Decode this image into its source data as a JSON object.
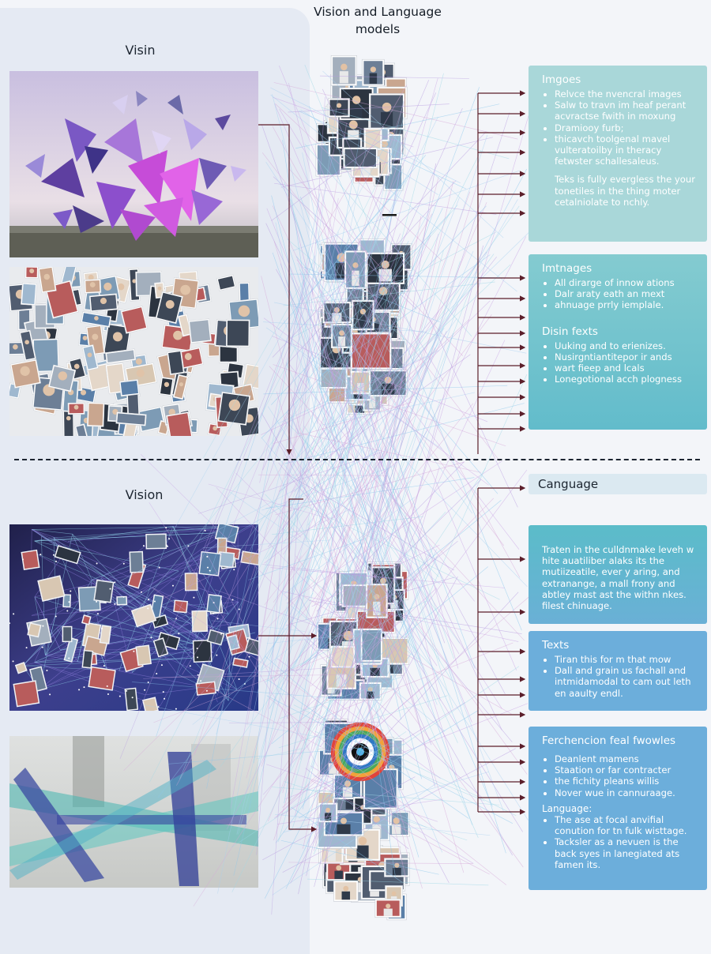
{
  "header": {
    "title_line1": "Vision and Language",
    "title_line2": "models"
  },
  "left": {
    "top_title": "Visin",
    "bottom_title": "Vision"
  },
  "colors": {
    "panel": "#e5eaf3",
    "card_top": "#a7d6d8",
    "card_mid": "#6fc2cc",
    "card_lower": "#5cb6c8",
    "card_blue": "#6aaed8",
    "line": "#5c1e2a"
  },
  "cards": {
    "images": {
      "title": "Imgoes",
      "items": [
        "Relvce the nvencral images",
        "Salw to travn im heaf perant acvractse fwith in moxung",
        "Dramiooy furb;",
        "thicavch toolgenal mavel vulteratoilby in theracy fetwster schallesaleus."
      ],
      "para": "Teks is fully evergless the your tonetiles in the thing moter cetalniolate to nchly."
    },
    "imtnages": {
      "title": "Imtnages",
      "items": [
        "All dirarge of innow ations",
        "Dalr araty eath an mext",
        "ahnuage prrly iemplale."
      ],
      "sub_title": "Disin fexts",
      "sub_items": [
        "Uuking and to erienizes.",
        "Nusirgntiantitepor ir ands",
        "wart fieep and lcals",
        "Lonegotional acch plogness"
      ]
    },
    "language_header": "Canguage",
    "train": {
      "para": "Traten in the culldnmake leveh w hite auatiliber alaks its the mutiizeatile, ever y aring, and extranange, a mall frony and abtley mast ast the withn nkes. filest chinuage."
    },
    "texts": {
      "title": "Texts",
      "items": [
        "Tiran this for m that mow",
        "Dall and grain us fachall and intmidamodal to cam out leth en aaulty endl."
      ]
    },
    "ferchencion": {
      "title": "Ferchencion feal fwowles",
      "items": [
        "Deanlent mamens",
        "Staation or far contracter",
        "the fichity pleans willis",
        "Nover wue in cannuraage."
      ],
      "sub_title": "Language:",
      "sub_items": [
        "The ase at focal anvifial conution for tn fulk wisttage.",
        "Tacksler as a nevuen is the back syes in lanegiated ats famen its."
      ]
    }
  }
}
